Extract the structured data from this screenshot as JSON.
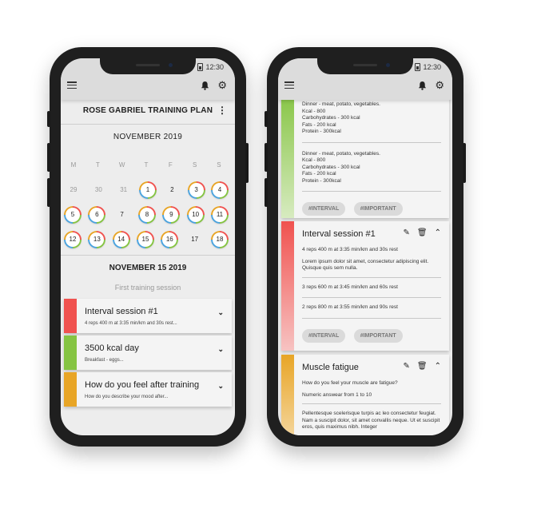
{
  "status": {
    "time": "12:30"
  },
  "left": {
    "plan_title": "ROSE GABRIEL TRAINING PLAN",
    "month": "NOVEMBER 2019",
    "weekdays": [
      "M",
      "T",
      "W",
      "T",
      "F",
      "S",
      "S"
    ],
    "weeks": [
      [
        {
          "d": "29",
          "t": "muted"
        },
        {
          "d": "30",
          "t": "muted"
        },
        {
          "d": "31",
          "t": "muted"
        },
        {
          "d": "1",
          "t": "ring"
        },
        {
          "d": "2",
          "t": "plain"
        },
        {
          "d": "3",
          "t": "ring"
        },
        {
          "d": "4",
          "t": "ring"
        }
      ],
      [
        {
          "d": "5",
          "t": "ring"
        },
        {
          "d": "6",
          "t": "ring"
        },
        {
          "d": "7",
          "t": "plain"
        },
        {
          "d": "8",
          "t": "ring"
        },
        {
          "d": "9",
          "t": "ring"
        },
        {
          "d": "10",
          "t": "ring"
        },
        {
          "d": "11",
          "t": "ring"
        }
      ],
      [
        {
          "d": "12",
          "t": "ring"
        },
        {
          "d": "13",
          "t": "ring"
        },
        {
          "d": "14",
          "t": "ring"
        },
        {
          "d": "15",
          "t": "ring"
        },
        {
          "d": "16",
          "t": "ring"
        },
        {
          "d": "17",
          "t": "plain"
        },
        {
          "d": "18",
          "t": "ring"
        }
      ]
    ],
    "selected_date": "NOVEMBER 15 2019",
    "session_label": "First training session",
    "cards": [
      {
        "title": "Interval session #1",
        "subtitle": "4 reps 400 m at 3:35 min/km and 30s rest...",
        "color": "#f0524f"
      },
      {
        "title": "3500 kcal day",
        "subtitle": "Breakfast - eggs...",
        "color": "#85c442"
      },
      {
        "title": "How do you feel after training",
        "subtitle": "How do you describe your mood after...",
        "color": "#e8a526"
      }
    ]
  },
  "right": {
    "nutrition_top": [
      "Dinner - meat, potato, vegetables.",
      "Kcal - 800",
      "Carbohydrates - 300 kcal",
      "Fats - 200 kcal",
      "Protein - 300kcal"
    ],
    "nutrition_mid": [
      "Dinner - meat, potato, vegetables.",
      "Kcal - 800",
      "Carbohydrates - 300 kcal",
      "Fats - 200 kcal",
      "Protein - 300kcal"
    ],
    "tags": [
      "#INTERVAL",
      "#IMPORTANT"
    ],
    "interval": {
      "title": "Interval session #1",
      "line1": "4 reps 400 m at 3:35 min/km and 30s rest",
      "lorem": "Lorem ipsum dolor sit amet, consectetur adipiscing elit. Quisque quis sem nulla.",
      "line2": "3 reps 600 m at 3:45 min/km and 60s rest",
      "line3": "2 reps 800 m at 3:55 min/km and 90s rest",
      "tags": [
        "#INTERVAL",
        "#IMPORTANT"
      ]
    },
    "fatigue": {
      "title": "Muscle fatigue",
      "question": "How do you feel your muscle are fatigue?",
      "answer": "Numeric answear from 1 to 10",
      "body": "Pellentesque scelerisque turpis ac leo consectetur feugiat. Nam a suscipit dolor, sit amet convallis neque. Ut et suscipit eros, quis maximus nibh. Integer"
    },
    "colors": {
      "green": "#85c442",
      "red": "#f0524f",
      "orange": "#e8a526"
    }
  }
}
